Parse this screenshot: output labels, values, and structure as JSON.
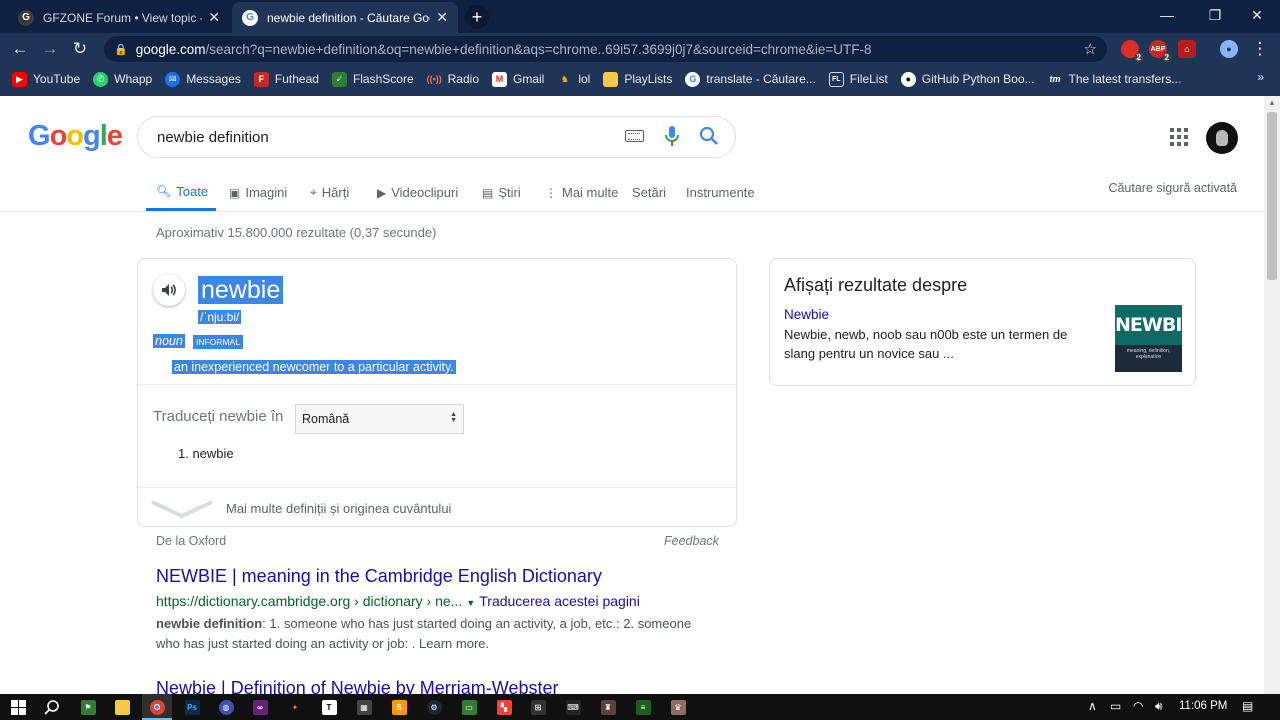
{
  "browser": {
    "tabs": [
      {
        "title": "GFZONE Forum • View topic - Re",
        "active": false
      },
      {
        "title": "newbie definition - Căutare Goog",
        "active": true
      }
    ],
    "address": {
      "host": "google.com",
      "path": "/search?q=newbie+definition&oq=newbie+definition&aqs=chrome..69i57.3699j0j7&sourceid=chrome&ie=UTF-8"
    },
    "extension_badges": [
      "2",
      "2"
    ],
    "bookmarks": [
      "YouTube",
      "Whapp",
      "Messages",
      "Futhead",
      "FlashScore",
      "Radio",
      "Gmail",
      "lol",
      "PlayLists",
      "translate - Căutare...",
      "FileList",
      "GitHub Python Boo...",
      "The latest transfers..."
    ],
    "bookmarks_more": "»"
  },
  "google": {
    "logo": "Google",
    "query": "newbie definition",
    "tabs": [
      {
        "label": "Toate",
        "icon": "search-icon",
        "active": true
      },
      {
        "label": "Imagini",
        "icon": "image-icon"
      },
      {
        "label": "Hărți",
        "icon": "map-icon"
      },
      {
        "label": "Videoclipuri",
        "icon": "video-icon"
      },
      {
        "label": "Știri",
        "icon": "news-icon"
      },
      {
        "label": "Mai multe",
        "icon": "more-vert-icon"
      },
      {
        "label": "Setări"
      },
      {
        "label": "Instrumente"
      }
    ],
    "safe_search": "Căutare sigură activată",
    "stats": "Aproximativ 15.800.000 rezultate (0,37 secunde)"
  },
  "dictionary": {
    "word": "newbie",
    "phonetic": "/ˈnjuːbi/",
    "pos": "noun",
    "label": "INFORMAL",
    "definition": "an inexperienced newcomer to a particular activity.",
    "translate_label": "Traduceți newbie în",
    "translate_language": "Română",
    "translation": "1.  newbie",
    "more": "Mai multe definiții și originea cuvântului",
    "source": "De la Oxford",
    "feedback": "Feedback"
  },
  "results": [
    {
      "title": "NEWBIE | meaning in the Cambridge English Dictionary",
      "url": "https://dictionary.cambridge.org › dictionary › ne...",
      "translate": "Traducerea acestei pagini",
      "snippet_bold": "newbie definition",
      "snippet": ": 1. someone who has just started doing an activity, a job, etc.: 2. someone who has just started doing an activity or job: . Learn more."
    },
    {
      "title": "Newbie | Definition of Newbie by Merriam-Webster"
    }
  ],
  "knowledge_panel": {
    "heading": "Afișați rezultate despre",
    "link": "Newbie",
    "text": "Newbie, newb, noob sau n00b este un termen de slang pentru un novice sau ...",
    "image_title": "NEWBIE",
    "image_caption": "meaning, definition, explanation"
  },
  "taskbar": {
    "clock": "11:06 PM"
  },
  "colors": {
    "chrome_frame": "#0f2140",
    "chrome_toolbar": "#1f3557",
    "link": "#1a0dab",
    "url_green": "#006621",
    "highlight": "#3b87e6",
    "accent": "#1a73e8"
  }
}
